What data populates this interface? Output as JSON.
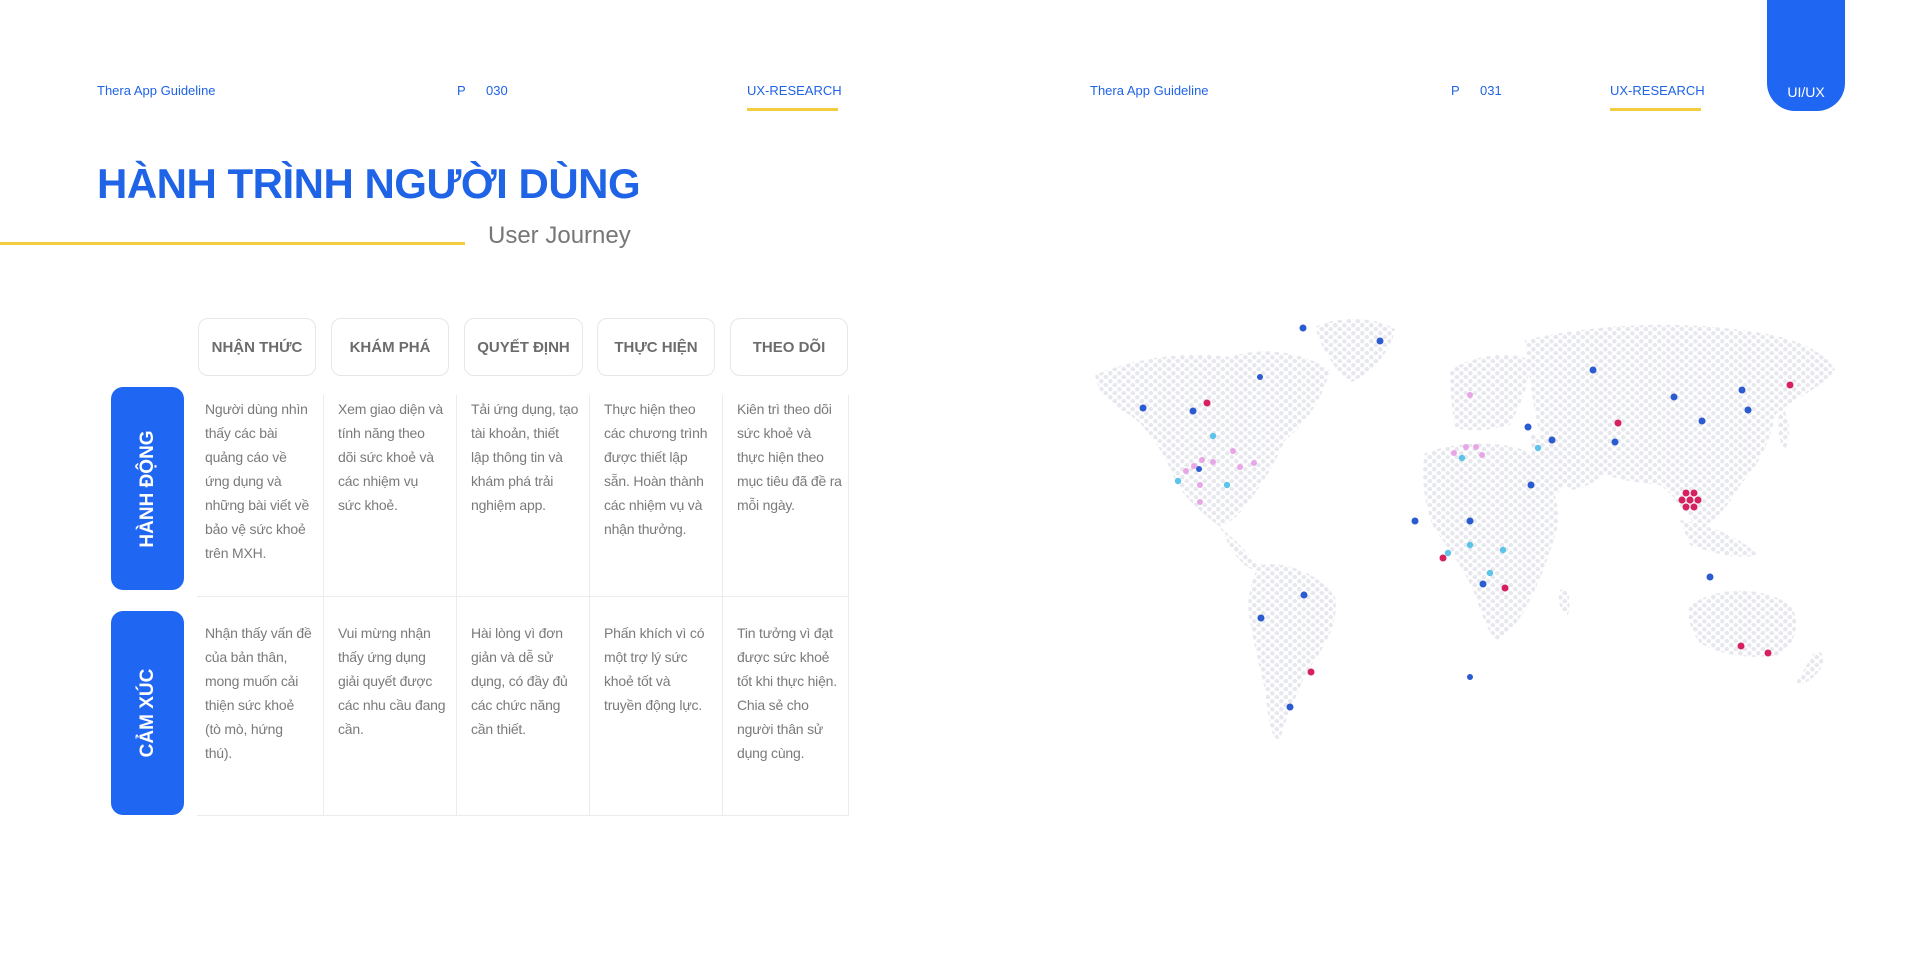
{
  "left_header": {
    "brand": "Thera App Guideline",
    "page_prefix": "P",
    "page_number": "030",
    "section": "UX-RESEARCH"
  },
  "right_header": {
    "brand": "Thera App Guideline",
    "page_prefix": "P",
    "page_number": "031",
    "section": "UX-RESEARCH",
    "tab": "UI/UX"
  },
  "title": "HÀNH TRÌNH NGƯỜI DÙNG",
  "subtitle": "User Journey",
  "journey": {
    "stages": [
      "NHẬN THỨC",
      "KHÁM PHÁ",
      "QUYẾT ĐỊNH",
      "THỰC HIỆN",
      "THEO DÕI"
    ],
    "rows": [
      {
        "label": "HÀNH ĐỘNG",
        "cells": [
          "Người dùng nhìn thấy các bài quảng cáo về ứng dụng và những bài viết về bảo vệ sức khoẻ trên MXH.",
          "Xem giao diện và tính năng theo dõi sức khoẻ và các nhiệm vụ sức khoẻ.",
          "Tải ứng dụng, tạo tài khoản, thiết lập thông tin và khám phá trải nghiệm app.",
          "Thực hiện theo các chương trình được thiết lập sẵn. Hoàn thành các nhiệm vụ và nhận thưởng.",
          "Kiên trì theo dõi sức khoẻ và thực hiện theo mục tiêu đã đề ra mỗi ngày."
        ]
      },
      {
        "label": "CẢM XÚC",
        "cells": [
          "Nhận thấy vấn đề của bản thân, mong muốn cải thiện sức khoẻ (tò mò, hứng thú).",
          "Vui mừng nhận thấy ứng dụng giải quyết được các nhu cầu đang cần.",
          "Hài lòng vì đơn giản và dễ sử dụng, có đầy đủ các chức năng cần thiết.",
          "Phấn khích vì có một trợ lý sức khoẻ tốt và truyền động lực.",
          "Tin tưởng vì đạt được sức khoẻ tốt khi thực hiện. Chia sẻ cho người thân sử dụng cùng."
        ]
      }
    ]
  },
  "colors": {
    "primary_blue": "#1f66f2",
    "accent_yellow": "#f2cd3f",
    "map_dot": "#e7e8ee",
    "marker_blue": "#2b5bd0",
    "marker_red": "#d6215f",
    "marker_cyan": "#5ec3e8",
    "marker_pink": "#e8a6e6"
  },
  "map": {
    "icon": "world-map-dotted"
  }
}
